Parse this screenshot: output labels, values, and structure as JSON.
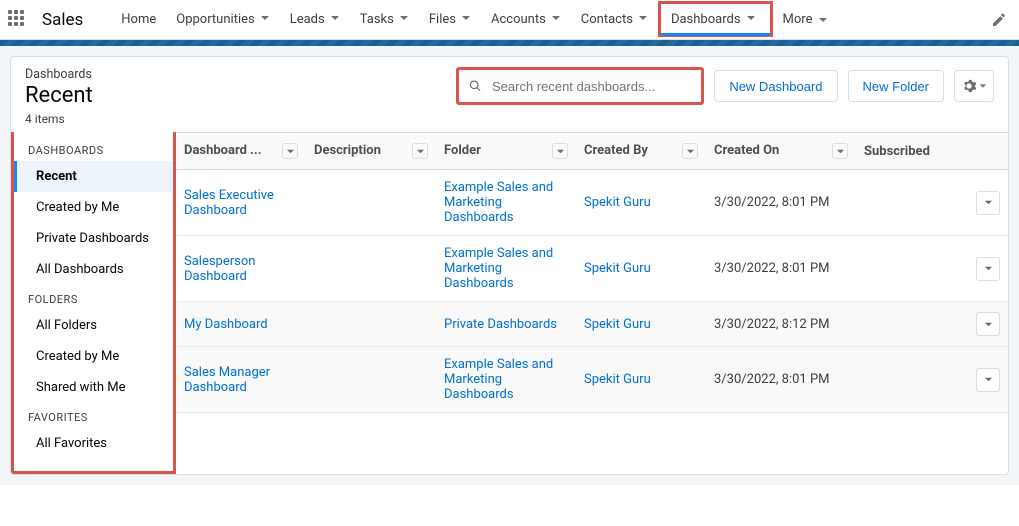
{
  "app_name": "Sales",
  "nav": [
    {
      "label": "Home",
      "has_menu": false
    },
    {
      "label": "Opportunities",
      "has_menu": true
    },
    {
      "label": "Leads",
      "has_menu": true
    },
    {
      "label": "Tasks",
      "has_menu": true
    },
    {
      "label": "Files",
      "has_menu": true
    },
    {
      "label": "Accounts",
      "has_menu": true
    },
    {
      "label": "Contacts",
      "has_menu": true
    },
    {
      "label": "Dashboards",
      "has_menu": true,
      "selected": true
    }
  ],
  "nav_more": "More",
  "header": {
    "eyebrow": "Dashboards",
    "title": "Recent",
    "count": "4 items",
    "search_placeholder": "Search recent dashboards...",
    "new_dashboard": "New Dashboard",
    "new_folder": "New Folder"
  },
  "sidebar": {
    "group1": {
      "label": "DASHBOARDS",
      "items": [
        "Recent",
        "Created by Me",
        "Private Dashboards",
        "All Dashboards"
      ]
    },
    "group2": {
      "label": "FOLDERS",
      "items": [
        "All Folders",
        "Created by Me",
        "Shared with Me"
      ]
    },
    "group3": {
      "label": "FAVORITES",
      "items": [
        "All Favorites"
      ]
    }
  },
  "columns": {
    "name": "Dashboard ...",
    "desc": "Description",
    "folder": "Folder",
    "created_by": "Created By",
    "created_on": "Created On",
    "subscribed": "Subscribed"
  },
  "rows": [
    {
      "name": "Sales Executive Dashboard",
      "desc": "",
      "folder": "Example Sales and Marketing Dashboards",
      "created_by": "Spekit Guru",
      "created_on": "3/30/2022, 8:01 PM"
    },
    {
      "name": "Salesperson Dashboard",
      "desc": "",
      "folder": "Example Sales and Marketing Dashboards",
      "created_by": "Spekit Guru",
      "created_on": "3/30/2022, 8:01 PM"
    },
    {
      "name": "My Dashboard",
      "desc": "",
      "folder": "Private Dashboards",
      "created_by": "Spekit Guru",
      "created_on": "3/30/2022, 8:12 PM"
    },
    {
      "name": "Sales Manager Dashboard",
      "desc": "",
      "folder": "Example Sales and Marketing Dashboards",
      "created_by": "Spekit Guru",
      "created_on": "3/30/2022, 8:01 PM"
    }
  ]
}
